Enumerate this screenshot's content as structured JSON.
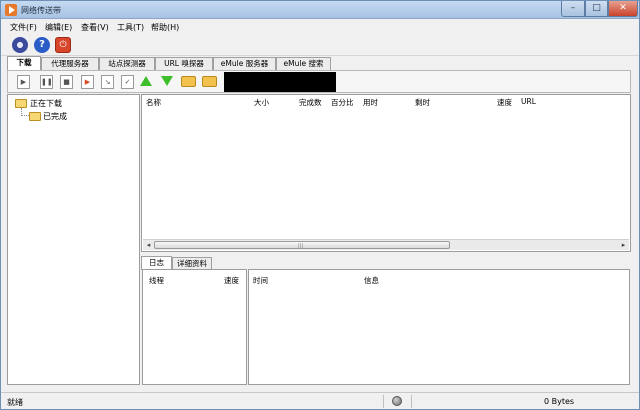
{
  "window": {
    "title": "网络传送带"
  },
  "menu": [
    "文件(F)",
    "编辑(E)",
    "查看(V)",
    "工具(T)",
    "帮助(H)"
  ],
  "tabs": [
    "下载",
    "代理服务器",
    "站点探测器",
    "URL 嗅探器",
    "eMule 服务器",
    "eMule 搜索"
  ],
  "tree": {
    "downloading": "正在下载",
    "completed": "已完成"
  },
  "columns": [
    "名称",
    "大小",
    "完成数",
    "百分比",
    "用时",
    "剩时",
    "速度",
    "URL"
  ],
  "bottom_tabs": [
    "日志",
    "详细资料"
  ],
  "thread_columns": [
    "线程",
    "速度"
  ],
  "log_columns": [
    "时间",
    "信息"
  ],
  "status": {
    "text": "就绪",
    "bytes": "0 Bytes"
  }
}
